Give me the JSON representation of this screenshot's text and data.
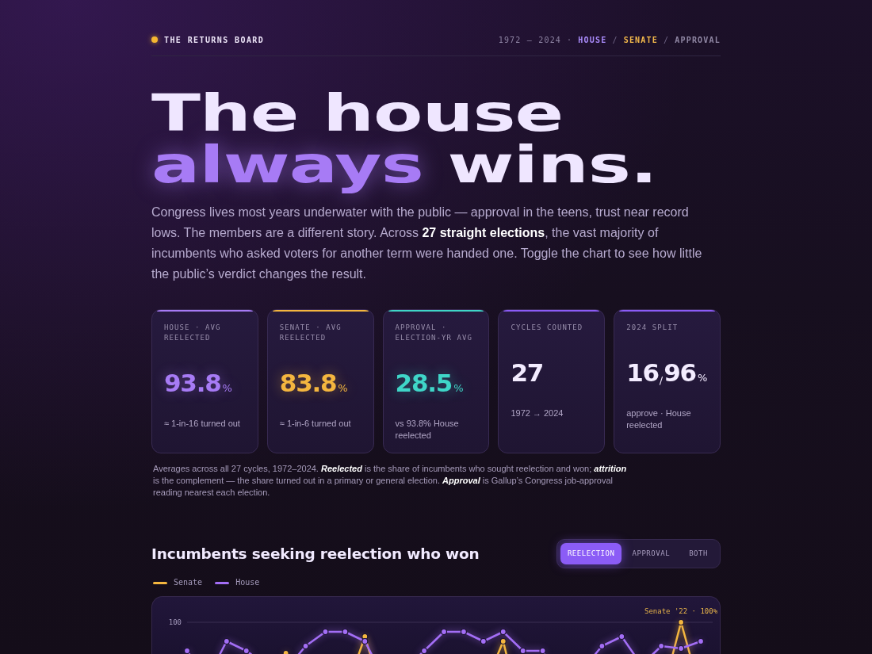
{
  "header": {
    "brand": "THE RETURNS BOARD",
    "range": "1972 – 2024",
    "range_separator": "·",
    "nav": [
      {
        "label": "HOUSE",
        "color": "#a98bfa"
      },
      {
        "separator": "/",
        "label": "SENATE",
        "color": "#f2b84b"
      },
      {
        "separator": "/",
        "label": "APPROVAL",
        "color": "#8f86a3"
      }
    ]
  },
  "headline": {
    "lines": [
      [
        {
          "text": "The house",
          "accent": false
        }
      ],
      [
        {
          "text": "always",
          "accent": true
        },
        {
          "text": "wins.",
          "accent": false
        }
      ]
    ]
  },
  "intro": "Congress lives most years underwater with the public — approval in the teens, trust near record lows. The members are a different story. Across **27 straight elections**, the vast majority of incumbents who asked voters for another term were handed one. Toggle the chart to see how little the public’s verdict changes the result.",
  "stats": [
    {
      "label": "HOUSE · AVG REELECTED",
      "value": "93.8",
      "unit": "%",
      "note": "≈ 1-in-16 turned out",
      "color": "#a77bf5",
      "highlight": true
    },
    {
      "label": "SENATE · AVG REELECTED",
      "value": "83.8",
      "unit": "%",
      "note": "≈ 1-in-6 turned out",
      "color": "#f4b63f",
      "highlight": true
    },
    {
      "label": "APPROVAL · ELECTION-YR AVG",
      "value": "28.5",
      "unit": "%",
      "note": "vs 93.8% House reelected",
      "color": "#3fd6c8",
      "highlight": true
    },
    {
      "label": "CYCLES COUNTED",
      "value": "27",
      "note": "1972 → 2024",
      "color": "#8b5cf6",
      "highlight": false
    },
    {
      "label": "2024 SPLIT",
      "value": "16$_{/}$96",
      "unit": "%",
      "note": "approve · House reelected",
      "color": "#8b5cf6",
      "highlight": false
    }
  ],
  "footnote": "Averages across all 27 cycles, 1972–2024. *Reelected* is the share of incumbents who sought reelection and won; *attrition* is the complement — the share turned out in a primary or general election. *Approval* is Gallup’s Congress job-approval reading nearest each election.",
  "chart_section": {
    "title": "Incumbents seeking reelection who won",
    "toggle": [
      {
        "label": "REELECTION",
        "selected": true
      },
      {
        "label": "APPROVAL",
        "selected": false
      },
      {
        "label": "BOTH",
        "selected": false
      }
    ],
    "legend": [
      {
        "label": "Senate",
        "color": "#f4b63f"
      },
      {
        "label": "House",
        "color": "#a36ef5"
      }
    ],
    "axis_label": "100",
    "callout": "Senate '22 · 100%"
  }
}
